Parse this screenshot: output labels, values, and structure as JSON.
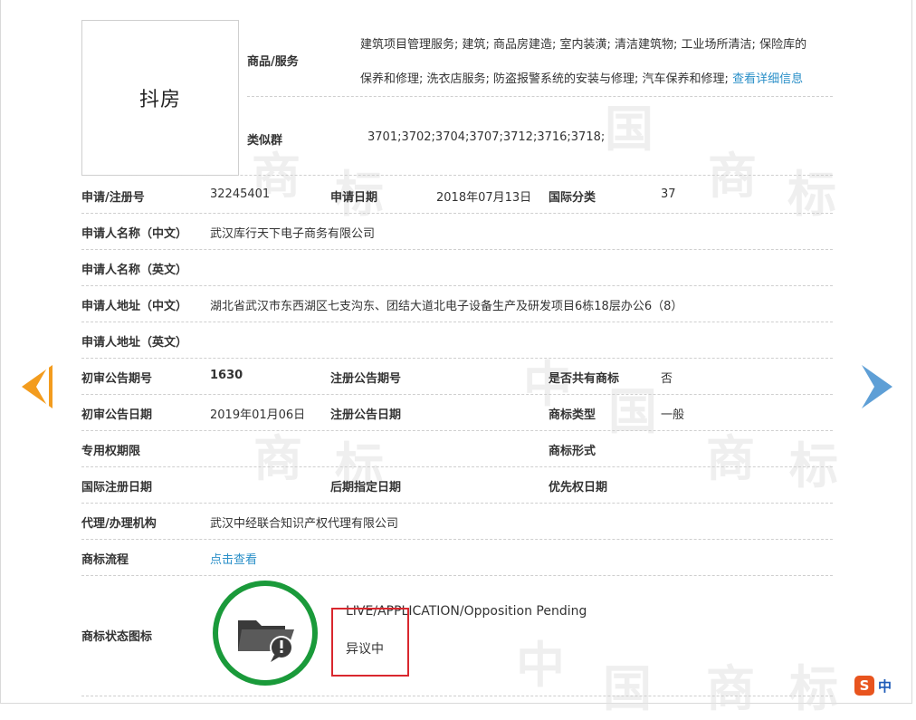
{
  "trademark": {
    "name": "抖房"
  },
  "goods": {
    "label": "商品/服务",
    "line1": "建筑项目管理服务; 建筑; 商品房建造; 室内装潢; 清洁建筑物; 工业场所清洁; 保险库的",
    "line2": "保养和修理; 洗衣店服务; 防盗报警系统的安装与修理; 汽车保养和修理;",
    "detail_link": "查看详细信息"
  },
  "similar_group": {
    "label": "类似群",
    "value": "3701;3702;3704;3707;3712;3716;3718;"
  },
  "fields": {
    "reg_no": {
      "label": "申请/注册号",
      "value": "32245401"
    },
    "app_date": {
      "label": "申请日期",
      "value": "2018年07月13日"
    },
    "intl_class": {
      "label": "国际分类",
      "value": "37"
    },
    "applicant_cn": {
      "label": "申请人名称（中文）",
      "value": "武汉库行天下电子商务有限公司"
    },
    "applicant_en": {
      "label": "申请人名称（英文）",
      "value": ""
    },
    "address_cn": {
      "label": "申请人地址（中文）",
      "value": "湖北省武汉市东西湖区七支沟东、团结大道北电子设备生产及研发项目6栋18层办公6（8）"
    },
    "address_en": {
      "label": "申请人地址（英文）",
      "value": ""
    },
    "prelim_issue": {
      "label": "初审公告期号",
      "value": "1630"
    },
    "reg_issue": {
      "label": "注册公告期号",
      "value": ""
    },
    "shared": {
      "label": "是否共有商标",
      "value": "否"
    },
    "prelim_date": {
      "label": "初审公告日期",
      "value": "2019年01月06日"
    },
    "reg_date": {
      "label": "注册公告日期",
      "value": ""
    },
    "tm_type": {
      "label": "商标类型",
      "value": "一般"
    },
    "exclusive_period": {
      "label": "专用权期限",
      "value": ""
    },
    "tm_form": {
      "label": "商标形式",
      "value": ""
    },
    "intl_reg_date": {
      "label": "国际注册日期",
      "value": ""
    },
    "later_date": {
      "label": "后期指定日期",
      "value": ""
    },
    "priority_date": {
      "label": "优先权日期",
      "value": ""
    },
    "agent": {
      "label": "代理/办理机构",
      "value": "武汉中经联合知识产权代理有限公司"
    },
    "flow": {
      "label": "商标流程",
      "value": "点击查看"
    }
  },
  "status": {
    "label": "商标状态图标",
    "en": "LIVE/APPLICATION/Opposition Pending",
    "cn": "异议中",
    "icon": "folder-alert-icon",
    "ring_color": "#1a9a3a",
    "highlight_color": "#d9272e"
  },
  "ime": {
    "logo": "S",
    "text": "中"
  },
  "colors": {
    "link": "#2a8fc8",
    "arrow_left": "#f39c1e",
    "arrow_right": "#5e9fd6"
  }
}
